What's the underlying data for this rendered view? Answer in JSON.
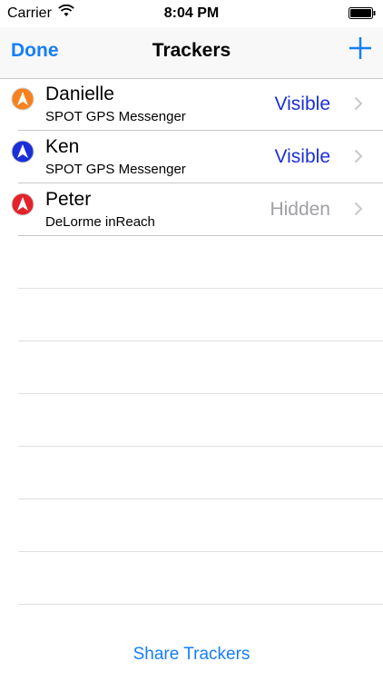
{
  "status_bar": {
    "carrier": "Carrier",
    "time": "8:04 PM"
  },
  "nav": {
    "done_label": "Done",
    "title": "Trackers",
    "add_icon": "plus-icon"
  },
  "trackers": [
    {
      "name": "Danielle",
      "device": "SPOT GPS Messenger",
      "status": "Visible",
      "pin_color": "#f5821f"
    },
    {
      "name": "Ken",
      "device": "SPOT GPS Messenger",
      "status": "Visible",
      "pin_color": "#1a2fd8"
    },
    {
      "name": "Peter",
      "device": "DeLorme inReach",
      "status": "Hidden",
      "pin_color": "#e3232b"
    }
  ],
  "share_label": "Share Trackers",
  "colors": {
    "accent": "#157efb",
    "visible": "#1b2fd6",
    "hidden": "#a0a0a5"
  }
}
